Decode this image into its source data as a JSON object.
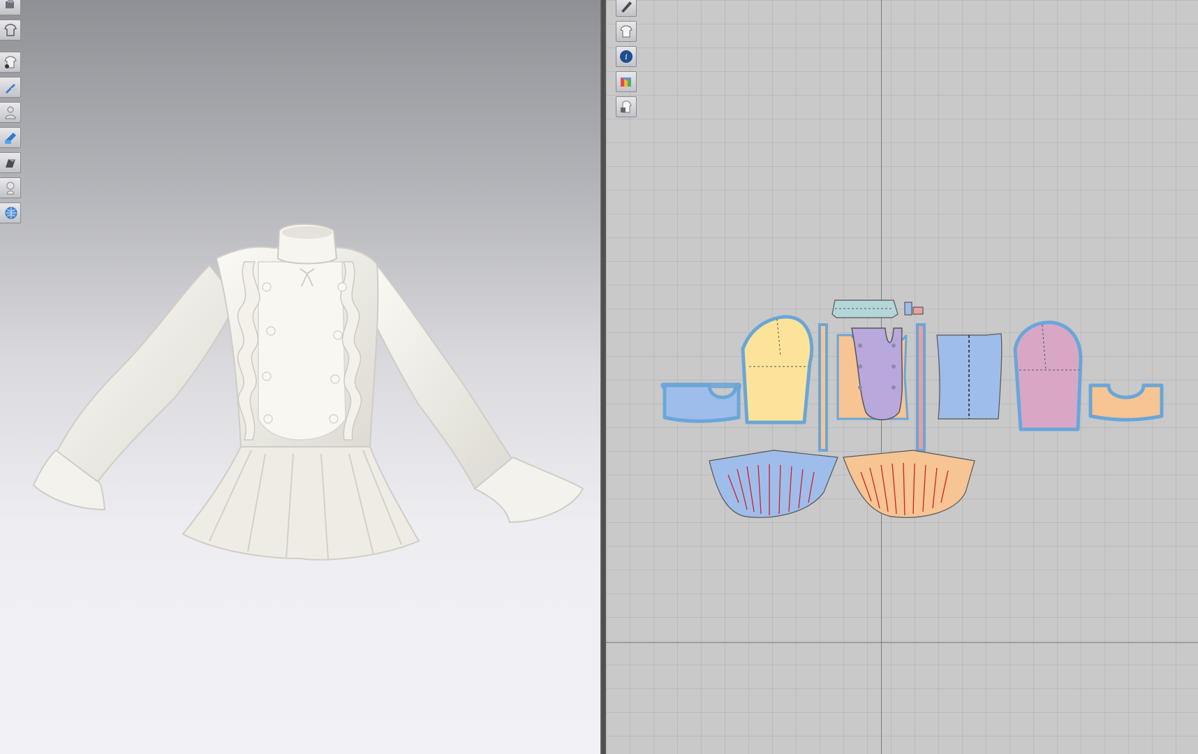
{
  "app": {
    "view_3d": "3d-garment-view",
    "view_2d": "2d-pattern-view"
  },
  "toolbar_3d": {
    "icons": [
      "display-avatar-icon",
      "garment-display-icon",
      "show-garment-icon",
      "show-3d-pen-icon",
      "show-avatar-icon",
      "texture-display-icon",
      "avatar-shading-icon",
      "avatar-display-icon",
      "fabric-mesh-icon"
    ]
  },
  "toolbar_2d": {
    "icons": [
      "pen-tool-icon",
      "show-pattern-icon",
      "info-icon",
      "fabric-color-icon",
      "lock-pattern-icon"
    ]
  },
  "colors": {
    "garment": "#f1efe8",
    "piece_blue": "#9fbdea",
    "piece_yellow": "#fde39a",
    "piece_orange": "#f7c494",
    "piece_purple": "#b8a8dc",
    "piece_pink": "#d8a7c6",
    "piece_teal": "#b4d6d8",
    "piece_red": "#e8a0a0",
    "outline": "#6aa6d8"
  }
}
